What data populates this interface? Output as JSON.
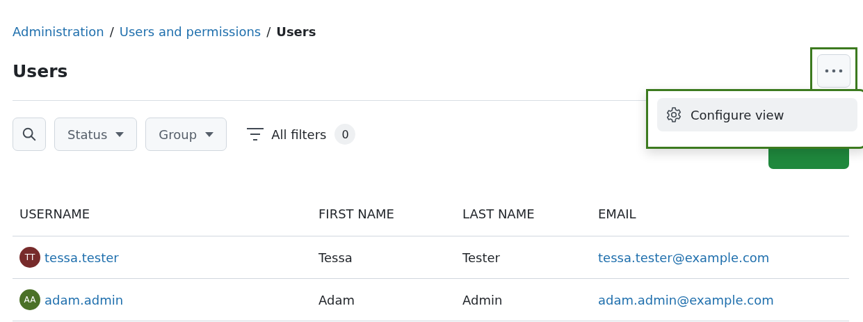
{
  "breadcrumb": {
    "separator": "/",
    "items": [
      {
        "label": "Administration",
        "current": false
      },
      {
        "label": "Users and permissions",
        "current": false
      },
      {
        "label": "Users",
        "current": true
      }
    ]
  },
  "title": "Users",
  "filters": [
    {
      "label": "Status"
    },
    {
      "label": "Group"
    }
  ],
  "all_filters": {
    "label": "All filters",
    "count": "0"
  },
  "menu": {
    "items": [
      {
        "label": "Configure view",
        "selected": true
      }
    ]
  },
  "table": {
    "columns": [
      "USERNAME",
      "FIRST NAME",
      "LAST NAME",
      "EMAIL"
    ],
    "rows": [
      {
        "initials": "TT",
        "color": "#772b2b",
        "username": "tessa.tester",
        "first_name": "Tessa",
        "last_name": "Tester",
        "email": "tessa.tester@example.com"
      },
      {
        "initials": "AA",
        "color": "#4b7127",
        "username": "adam.admin",
        "first_name": "Adam",
        "last_name": "Admin",
        "email": "adam.admin@example.com"
      }
    ]
  }
}
